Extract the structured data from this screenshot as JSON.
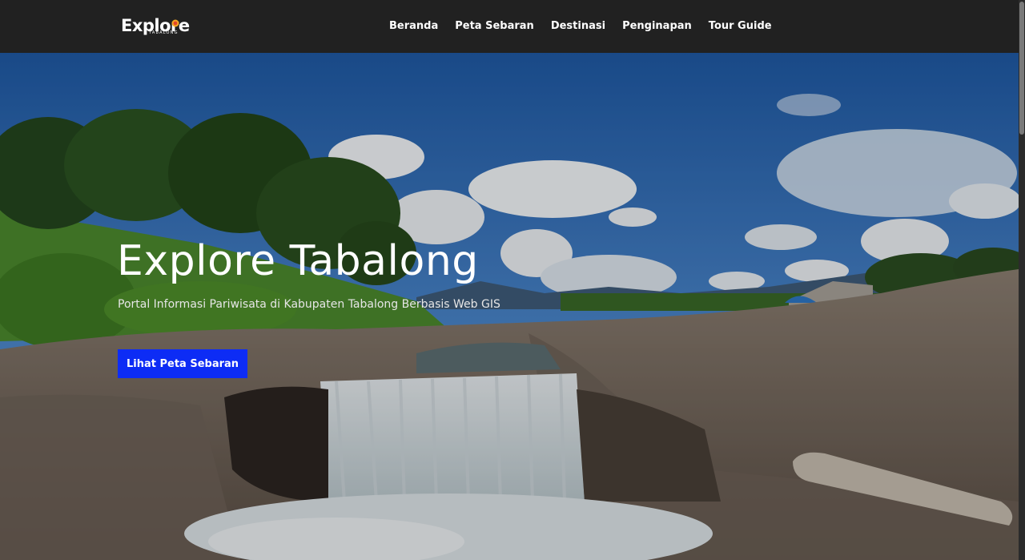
{
  "brand": {
    "logo_text": "Explore",
    "logo_subtext": "TABALONG",
    "colors": {
      "navbar": "#212121",
      "accent": "#0d2cf5",
      "sun": "#f5a623"
    }
  },
  "nav": {
    "items": [
      {
        "label": "Beranda"
      },
      {
        "label": "Peta Sebaran"
      },
      {
        "label": "Destinasi"
      },
      {
        "label": "Penginapan"
      },
      {
        "label": "Tour Guide"
      }
    ]
  },
  "hero": {
    "title": "Explore Tabalong",
    "subtitle": "Portal Informasi Pariwisata di Kabupaten Tabalong Berbasis Web GIS",
    "button_label": "Lihat Peta Sebaran",
    "background": "river-waterfall-landscape"
  }
}
